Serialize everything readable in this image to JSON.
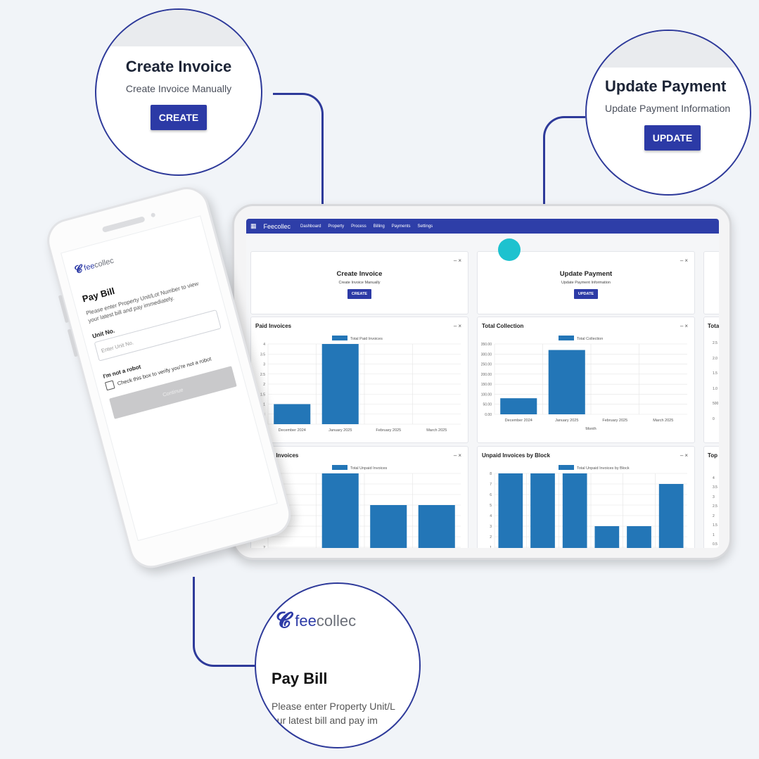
{
  "callouts": {
    "create": {
      "title": "Create Invoice",
      "subtitle": "Create Invoice Manually",
      "button": "CREATE"
    },
    "update": {
      "title": "Update Payment",
      "subtitle": "Update Payment Information",
      "button": "UPDATE"
    },
    "paybill": {
      "logo_prefix": "fee",
      "logo_suffix": "collec",
      "title": "Pay Bill",
      "text_line1": "Please enter Property Unit/L",
      "text_line2": "our latest bill and pay im"
    }
  },
  "dashboard": {
    "brand": "Feecollec",
    "nav": [
      "Dashboard",
      "Property",
      "Process",
      "Billing",
      "Payments",
      "Settings"
    ],
    "cards": {
      "create": {
        "title": "Create Invoice",
        "subtitle": "Create Invoice Manually",
        "button": "CREATE"
      },
      "update": {
        "title": "Update Payment",
        "subtitle": "Update Payment Information",
        "button": "UPDATE"
      },
      "paid_title": "Paid Invoices",
      "collection_title": "Total Collection",
      "unpaid_title": "Unpaid Invoices",
      "block_title": "Unpaid Invoices by Block",
      "partial_right_1": "Tota",
      "partial_right_2": "Top"
    },
    "right_axis_partial_1": [
      "2.5",
      "2.0",
      "1.5",
      "1.0",
      "500",
      "0"
    ],
    "right_axis_partial_2": [
      "4",
      "3.5",
      "3",
      "2.5",
      "2",
      "1.5",
      "1",
      "0.5"
    ]
  },
  "chart_data": [
    {
      "type": "bar",
      "title": "Paid Invoices",
      "legend": "Total Paid Invoices",
      "categories": [
        "December 2024",
        "January 2025",
        "February 2025",
        "March 2025"
      ],
      "values": [
        1,
        4,
        0,
        0
      ],
      "yticks": [
        "0",
        "0.5",
        "1",
        "1.5",
        "2",
        "2.5",
        "3",
        "3.5",
        "4"
      ],
      "ylim": [
        0,
        4
      ],
      "xlabel": "",
      "ylabel": "",
      "color": "#2376b7"
    },
    {
      "type": "bar",
      "title": "Total Collection",
      "legend": "Total Collection",
      "categories": [
        "December 2024",
        "January 2025",
        "February 2025",
        "March 2025"
      ],
      "values": [
        80,
        320,
        0,
        0
      ],
      "yticks": [
        "0.00",
        "50.00",
        "100.00",
        "150.00",
        "200.00",
        "250.00",
        "300.00",
        "350.00"
      ],
      "ylim": [
        0,
        350
      ],
      "xlabel": "Month",
      "ylabel": "",
      "color": "#2376b7"
    },
    {
      "type": "bar",
      "title": "Unpaid Invoices",
      "legend": "Total Unpaid Invoices",
      "categories": [
        "",
        "",
        "",
        ""
      ],
      "values": [
        1,
        16,
        10,
        10
      ],
      "yticks": [
        "0",
        "2",
        "4",
        "6",
        "8",
        "10",
        "12",
        "14",
        "16"
      ],
      "ylim": [
        0,
        16
      ],
      "xlabel": "",
      "ylabel": "",
      "color": "#2376b7"
    },
    {
      "type": "bar",
      "title": "Unpaid Invoices by Block",
      "legend": "Total Unpaid Invoices by Block",
      "categories": [
        "",
        "",
        "",
        "",
        "",
        ""
      ],
      "values": [
        8,
        8,
        8,
        3,
        3,
        7
      ],
      "yticks": [
        "0",
        "1",
        "2",
        "3",
        "4",
        "5",
        "6",
        "7",
        "8"
      ],
      "ylim": [
        0,
        8
      ],
      "xlabel": "",
      "ylabel": "",
      "color": "#2376b7"
    }
  ],
  "phone": {
    "logo_prefix": "fee",
    "logo_suffix": "collec",
    "title": "Pay Bill",
    "subtitle": "Please enter Property Unit/Lot Number to view your latest bill and pay immediately.",
    "unit_label": "Unit No.",
    "unit_placeholder": "Enter Unit No.",
    "robot_label": "I'm not a robot",
    "robot_check_label": "Check this box to verify you're not a robot",
    "continue_label": "Continue"
  },
  "colors": {
    "accent": "#2c3aa6",
    "bar": "#2376b7",
    "dot": "#1dc2cf"
  }
}
